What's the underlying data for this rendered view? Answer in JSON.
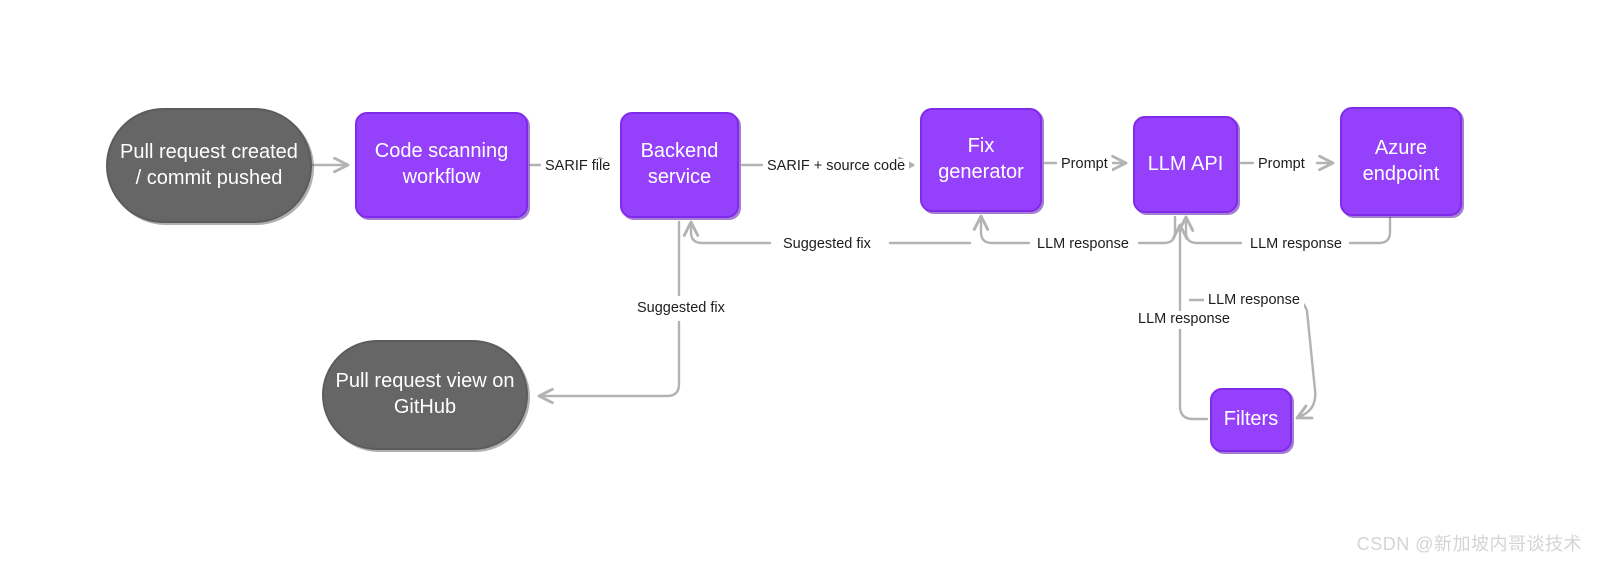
{
  "diagram": {
    "title": "Code scanning autofix architecture flow",
    "background": "#ffffff",
    "colors": {
      "purple_fill": "#9540fb",
      "purple_border": "#7f2bea",
      "gray_fill": "#666666",
      "gray_border": "#5c5c5c",
      "connector": "#b3b3b3",
      "label_text": "#1d1d1d",
      "node_text": "#ffffff",
      "watermark": "#d4d4d4"
    },
    "nodes": [
      {
        "id": "pull-request-trigger",
        "label": "Pull request created / commit pushed",
        "shape": "pill",
        "style": "gray"
      },
      {
        "id": "code-scanning-workflow",
        "label": "Code scanning workflow",
        "shape": "rounded-rect",
        "style": "purple"
      },
      {
        "id": "backend-service",
        "label": "Backend service",
        "shape": "rounded-rect",
        "style": "purple"
      },
      {
        "id": "fix-generator",
        "label": "Fix generator",
        "shape": "rounded-rect",
        "style": "purple"
      },
      {
        "id": "llm-api",
        "label": "LLM API",
        "shape": "rounded-rect",
        "style": "purple"
      },
      {
        "id": "azure-endpoint",
        "label": "Azure endpoint",
        "shape": "rounded-rect",
        "style": "purple"
      },
      {
        "id": "filters",
        "label": "Filters",
        "shape": "rounded-rect",
        "style": "purple"
      },
      {
        "id": "pull-request-view",
        "label": "Pull request view on GitHub",
        "shape": "pill",
        "style": "gray"
      }
    ],
    "edge_labels": [
      {
        "id": "sarif-file",
        "text": "SARIF file"
      },
      {
        "id": "sarif-source-code",
        "text": "SARIF + source code"
      },
      {
        "id": "prompt-to-llm-api",
        "text": "Prompt"
      },
      {
        "id": "prompt-to-azure",
        "text": "Prompt"
      },
      {
        "id": "llm-response-azure-to-llm-api",
        "text": "LLM response"
      },
      {
        "id": "llm-response-llm-api-to-fix-generator",
        "text": "LLM response"
      },
      {
        "id": "llm-response-azure-to-filters",
        "text": "LLM response"
      },
      {
        "id": "llm-response-filters-to-llm-api",
        "text": "LLM response"
      },
      {
        "id": "suggested-fix-to-backend",
        "text": "Suggested fix"
      },
      {
        "id": "suggested-fix-to-pr-view",
        "text": "Suggested fix"
      }
    ]
  },
  "watermark": {
    "text": "CSDN @新加坡内哥谈技术"
  }
}
